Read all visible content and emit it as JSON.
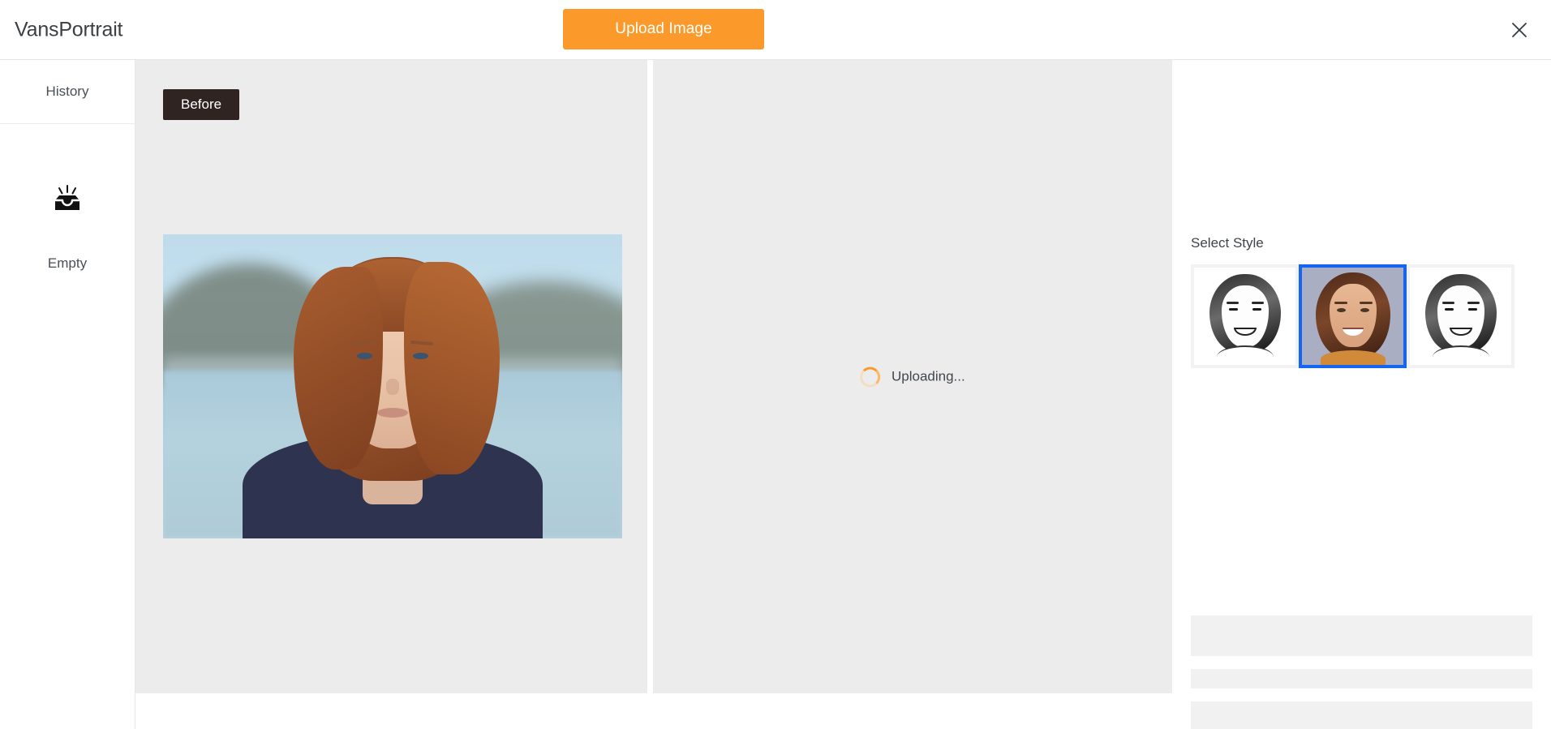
{
  "header": {
    "brand": "VansPortrait",
    "upload_label": "Upload Image",
    "close_icon": "close-icon"
  },
  "sidebar": {
    "history_label": "History",
    "empty_icon": "inbox-empty-icon",
    "empty_label": "Empty"
  },
  "canvas": {
    "before_badge": "Before",
    "uploading_text": "Uploading...",
    "spinner_icon": "spinner-icon",
    "source_photo_alt": "portrait of woman with auburn bob hair by a lake"
  },
  "right_panel": {
    "select_style_label": "Select Style",
    "styles": [
      {
        "name": "style-sketch-1",
        "selected": false,
        "kind": "sketch"
      },
      {
        "name": "style-painted-color",
        "selected": true,
        "kind": "painted"
      },
      {
        "name": "style-sketch-2",
        "selected": false,
        "kind": "sketch"
      }
    ]
  },
  "colors": {
    "accent_orange": "#fb9a2b",
    "selection_blue": "#1565f0",
    "badge_dark": "#2f2421",
    "canvas_gray": "#ececec",
    "skeleton_gray": "#f1f1f1"
  }
}
